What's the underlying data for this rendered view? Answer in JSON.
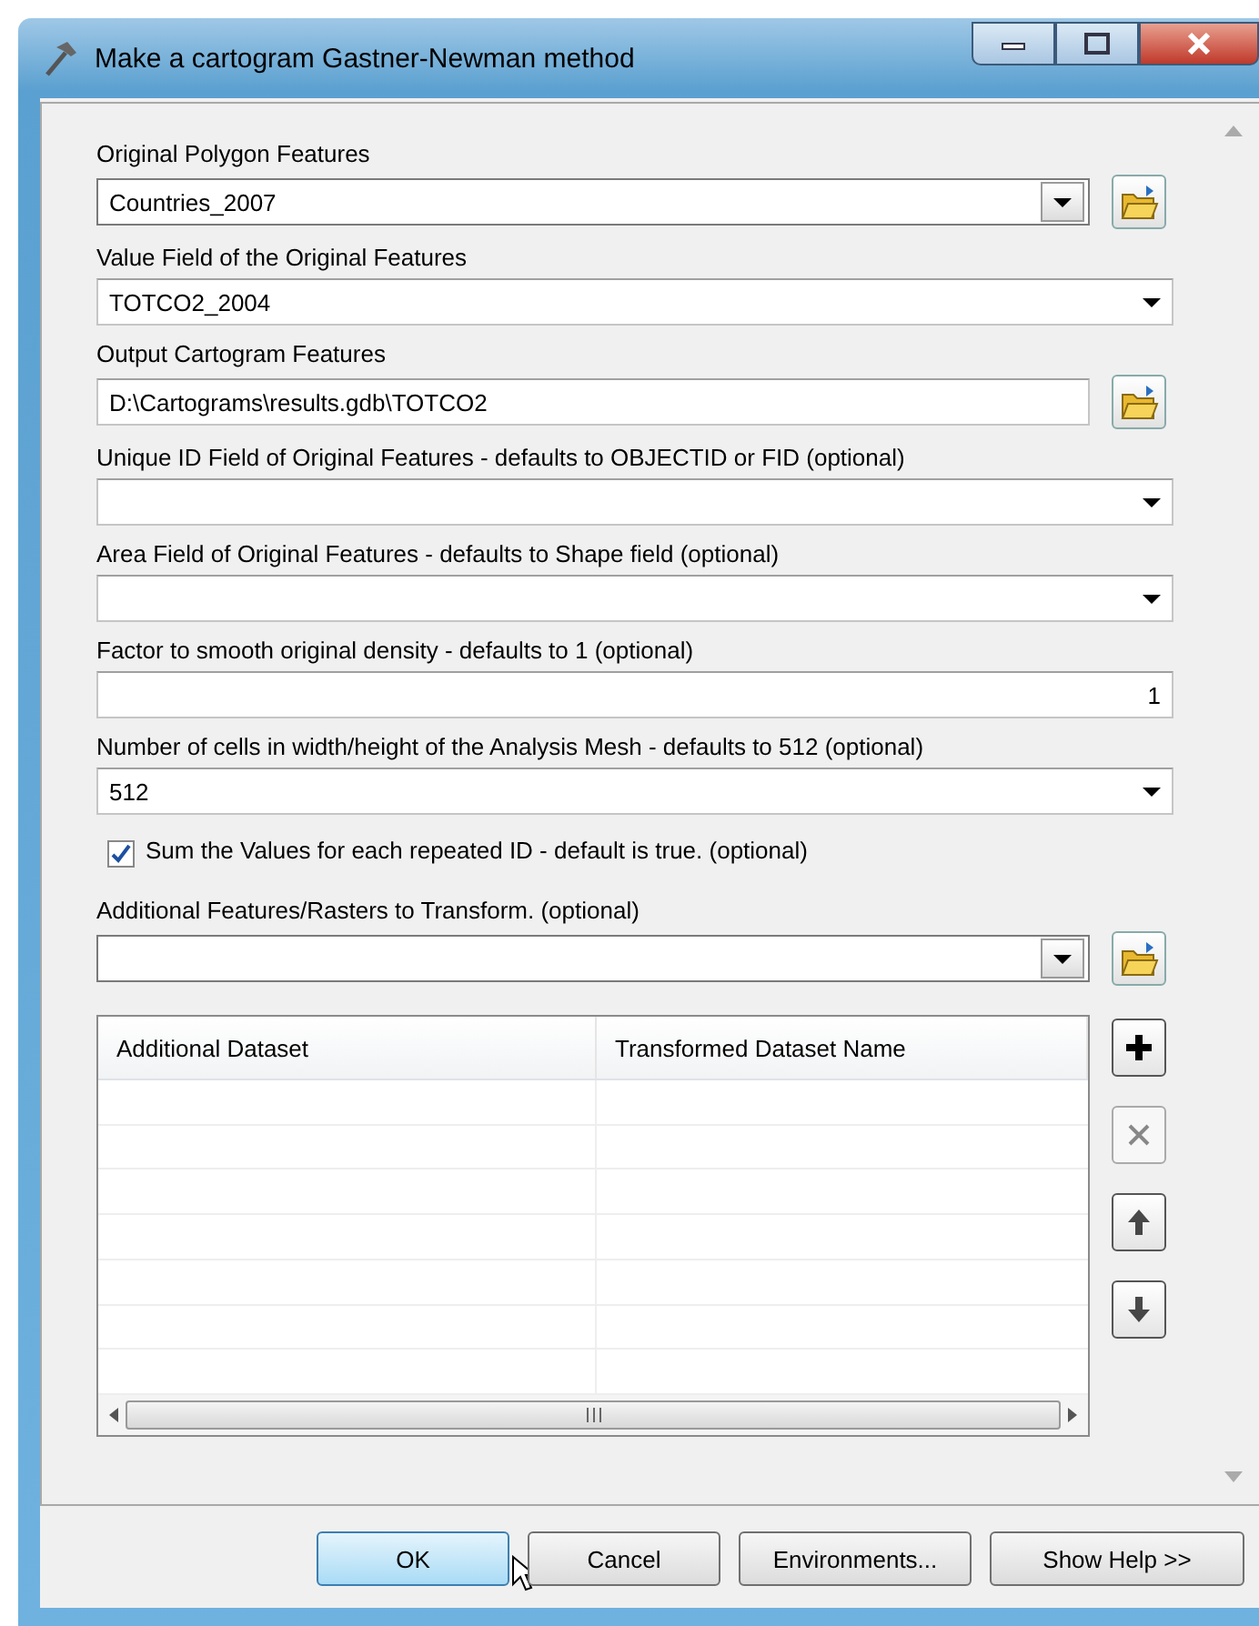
{
  "window": {
    "title": "Make a cartogram Gastner-Newman method"
  },
  "parameters": [
    {
      "kind": "combo-browse",
      "label": "Original Polygon Features",
      "value": "Countries_2007"
    },
    {
      "kind": "dropdown",
      "label": "Value Field of the Original Features",
      "value": "TOTCO2_2004"
    },
    {
      "kind": "text-browse",
      "label": "Output Cartogram Features",
      "value": "D:\\Cartograms\\results.gdb\\TOTCO2"
    },
    {
      "kind": "dropdown",
      "label": "Unique ID Field of Original Features - defaults to OBJECTID or FID (optional)"
    },
    {
      "kind": "dropdown",
      "label": "Area Field of Original Features - defaults to Shape field (optional)"
    },
    {
      "kind": "number",
      "label": "Factor to smooth original density - defaults to 1 (optional)",
      "value": "1"
    },
    {
      "kind": "dropdown",
      "label": "Number of cells in width/height of the Analysis Mesh - defaults to 512 (optional)",
      "value": "512"
    },
    {
      "kind": "checkbox",
      "label": "Sum the Values for each repeated ID - default is true. (optional)",
      "checked": true
    },
    {
      "kind": "combo-browse",
      "label": "Additional Features/Rasters to Transform. (optional)"
    }
  ],
  "table": {
    "columns": [
      "Additional Dataset",
      "Transformed Dataset Name"
    ]
  },
  "table_tools": [
    {
      "kind": "add",
      "disabled": false
    },
    {
      "kind": "remove",
      "disabled": true
    },
    {
      "kind": "up",
      "disabled": false
    },
    {
      "kind": "down",
      "disabled": false
    }
  ],
  "buttons": [
    {
      "label": "OK",
      "selected": true
    },
    {
      "label": "Cancel",
      "selected": false
    },
    {
      "label": "Environments...",
      "selected": false
    },
    {
      "label": "Show Help >>",
      "selected": false
    }
  ]
}
